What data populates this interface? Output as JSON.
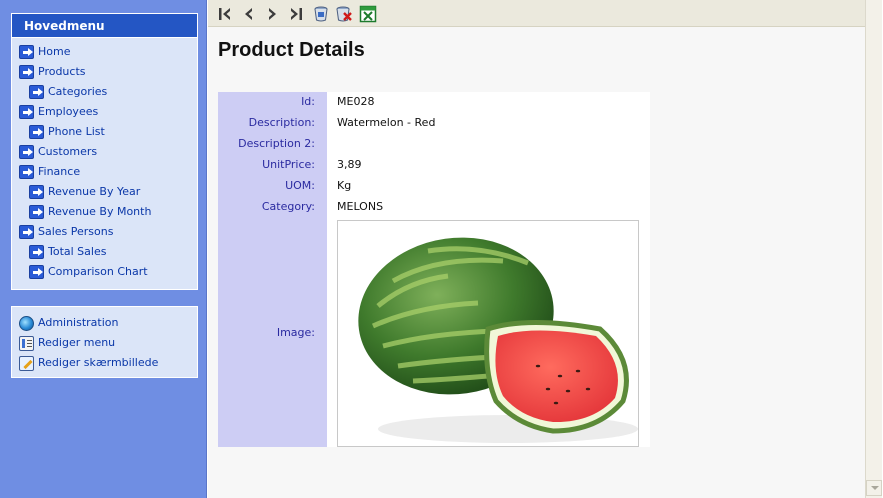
{
  "sidebar": {
    "menu_title": "Hovedmenu",
    "items": [
      {
        "label": "Home",
        "level": 0
      },
      {
        "label": "Products",
        "level": 0
      },
      {
        "label": "Categories",
        "level": 1
      },
      {
        "label": "Employees",
        "level": 0
      },
      {
        "label": "Phone List",
        "level": 1
      },
      {
        "label": "Customers",
        "level": 0
      },
      {
        "label": "Finance",
        "level": 0
      },
      {
        "label": "Revenue By Year",
        "level": 1
      },
      {
        "label": "Revenue By Month",
        "level": 1
      },
      {
        "label": "Sales Persons",
        "level": 0
      },
      {
        "label": "Total Sales",
        "level": 1
      },
      {
        "label": "Comparison Chart",
        "level": 1
      }
    ],
    "admin_items": [
      {
        "label": "Administration",
        "icon": "globe-icon"
      },
      {
        "label": "Rediger menu",
        "icon": "menu-edit-icon"
      },
      {
        "label": "Rediger skærmbillede",
        "icon": "screen-edit-icon"
      }
    ]
  },
  "toolbar": {
    "buttons": [
      "first-record-icon",
      "previous-record-icon",
      "next-record-icon",
      "last-record-icon",
      "save-icon",
      "delete-icon",
      "excel-export-icon"
    ]
  },
  "main": {
    "title": "Product Details",
    "fields": {
      "id": {
        "label": "Id:",
        "value": "ME028"
      },
      "description": {
        "label": "Description:",
        "value": "Watermelon - Red"
      },
      "description2": {
        "label": "Description 2:",
        "value": ""
      },
      "unitprice": {
        "label": "UnitPrice:",
        "value": "3,89"
      },
      "uom": {
        "label": "UOM:",
        "value": "Kg"
      },
      "category": {
        "label": "Category:",
        "value": "MELONS"
      },
      "image": {
        "label": "Image:"
      }
    }
  },
  "colors": {
    "sidebar_bg": "#6f8ee3",
    "menu_header": "#2456c4",
    "menu_bg": "#dbe5f8",
    "link": "#0a37a8",
    "label_bg": "#cdcdf4",
    "label_text": "#2a2aa0"
  }
}
